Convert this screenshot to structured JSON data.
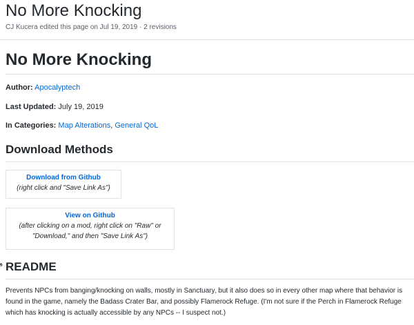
{
  "header": {
    "title": "No More Knocking",
    "meta": "CJ Kucera edited this page on Jul 19, 2019 · 2 revisions"
  },
  "article": {
    "title": "No More Knocking",
    "author_label": "Author:",
    "author_value": "Apocalyptech",
    "updated_label": "Last Updated:",
    "updated_value": "July 19, 2019",
    "categories_label": "In Categories:",
    "categories": [
      "Map Alterations",
      "General QoL"
    ],
    "categories_sep": ", "
  },
  "download": {
    "heading": "Download Methods",
    "github_download": {
      "link": "Download from Github",
      "note": "(right click and \"Save Link As\")"
    },
    "github_view": {
      "link": "View on Github",
      "note_line1": "(after clicking on a mod, right click on \"Raw\" or",
      "note_line2": "\"Download,\" and then \"Save Link As\")"
    }
  },
  "readme": {
    "heading": "README",
    "body": "Prevents NPCs from banging/knocking on walls, mostly in Sanctuary, but it also does so in every other map where that behavior is found in the game, namely the Badass Crater Bar, and possibly Flamerock Refuge. (I'm not sure if the Perch in Flamerock Refuge which has knocking is actually accessible by any NPCs -- I suspect not.)"
  },
  "colors": {
    "link": "#0366d6",
    "text": "#24292e",
    "muted": "#586069",
    "rule": "#e1e4e8"
  }
}
